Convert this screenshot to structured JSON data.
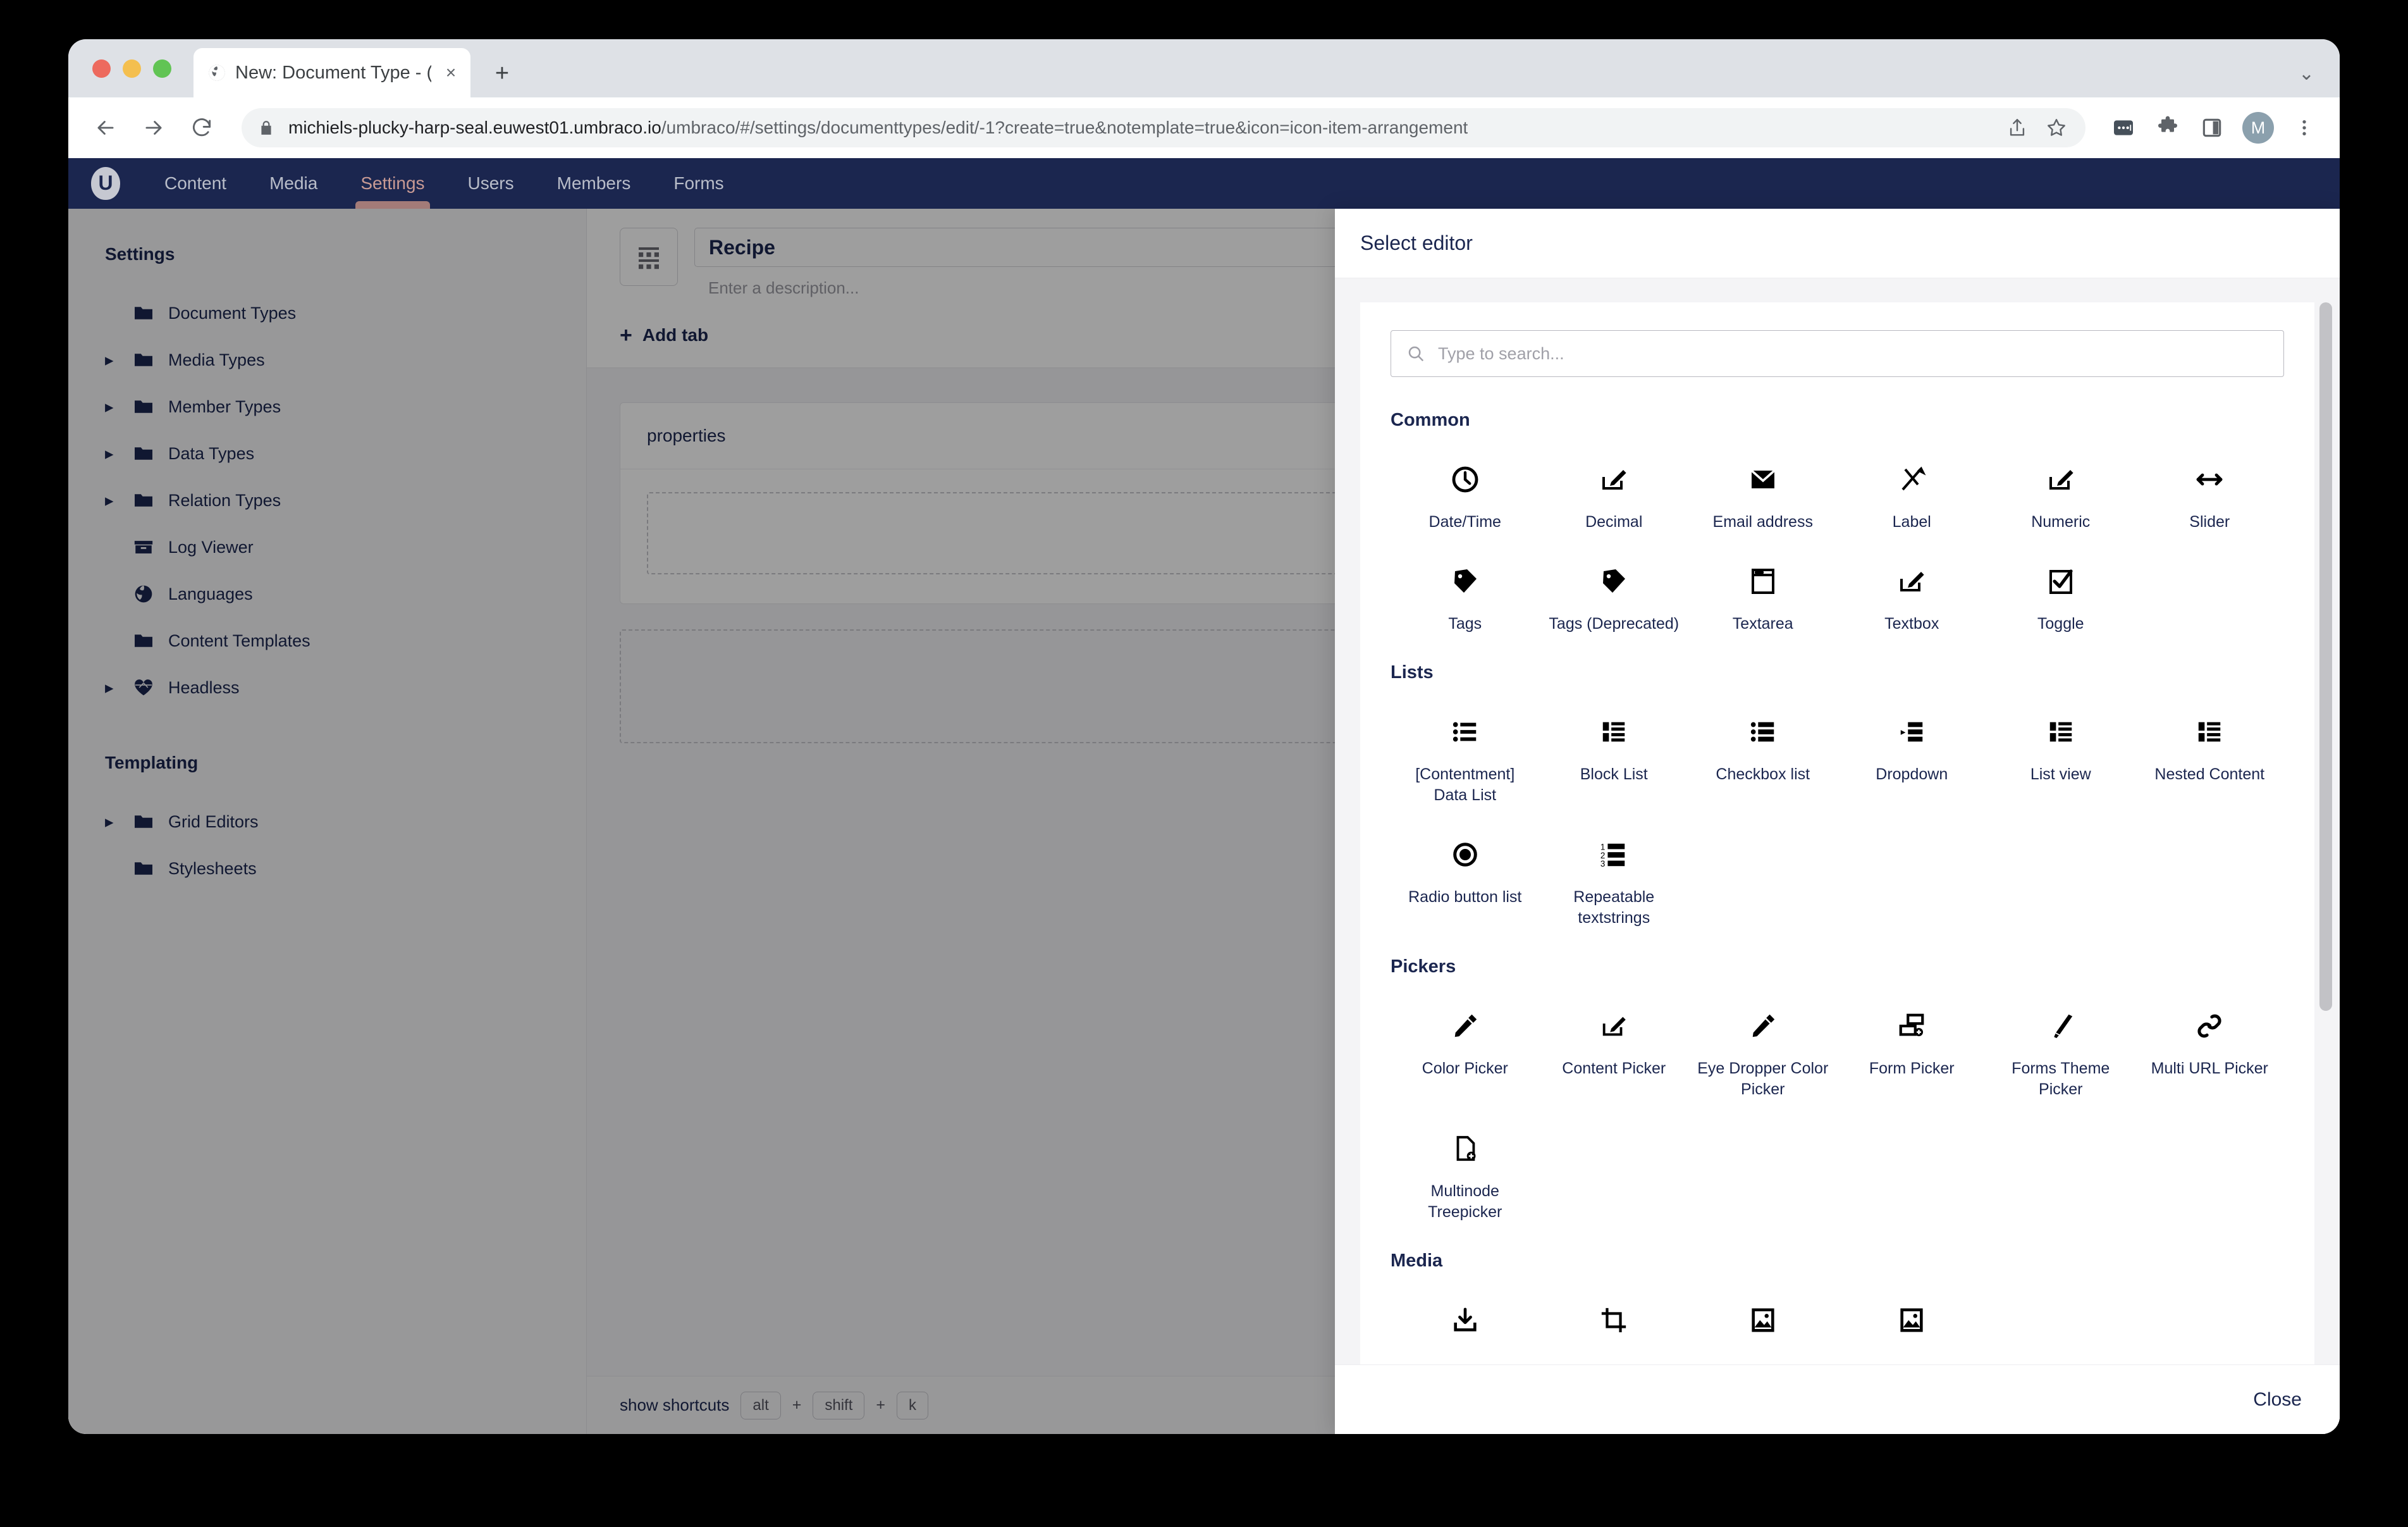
{
  "browser": {
    "tab": {
      "title": "New: Document Type - (Live) S",
      "favicon": "globe-icon",
      "close": "×"
    },
    "new_tab": "+",
    "tab_strip_chevron": "⌄",
    "url": {
      "host": "michiels-plucky-harp-seal.euwest01.umbraco.io",
      "path": "/umbraco/#/settings/documenttypes/edit/-1?create=true&notemplate=true&icon=icon-item-arrangement"
    },
    "toolbar": {
      "share": "share-icon",
      "bookmark": "star-icon",
      "passwords": "password-manager-icon",
      "extensions": "puzzle-icon",
      "sidepanel": "side-panel-icon",
      "profile_initial": "M",
      "menu": "three-dot-menu-icon"
    }
  },
  "umbraco_nav": {
    "logo": "U",
    "items": [
      {
        "label": "Content",
        "active": false
      },
      {
        "label": "Media",
        "active": false
      },
      {
        "label": "Settings",
        "active": true
      },
      {
        "label": "Users",
        "active": false
      },
      {
        "label": "Members",
        "active": false
      },
      {
        "label": "Forms",
        "active": false
      }
    ],
    "active_color": "#c89a94",
    "bar_color": "#1b264f"
  },
  "sidebar": {
    "heading": "Settings",
    "items": [
      {
        "label": "Document Types",
        "icon": "folder-icon",
        "expandable": false
      },
      {
        "label": "Media Types",
        "icon": "folder-icon",
        "expandable": true
      },
      {
        "label": "Member Types",
        "icon": "folder-icon",
        "expandable": true
      },
      {
        "label": "Data Types",
        "icon": "folder-icon",
        "expandable": true
      },
      {
        "label": "Relation Types",
        "icon": "folder-icon",
        "expandable": true
      },
      {
        "label": "Log Viewer",
        "icon": "box-icon",
        "expandable": false
      },
      {
        "label": "Languages",
        "icon": "globe-icon",
        "expandable": false
      },
      {
        "label": "Content Templates",
        "icon": "folder-icon",
        "expandable": false
      },
      {
        "label": "Headless",
        "icon": "heart-icon",
        "expandable": true
      }
    ],
    "heading2": "Templating",
    "items2": [
      {
        "label": "Grid Editors",
        "icon": "folder-icon",
        "expandable": true
      },
      {
        "label": "Stylesheets",
        "icon": "folder-icon",
        "expandable": false
      }
    ]
  },
  "editor": {
    "icon": "item-arrangement-icon",
    "name": "Recipe",
    "description_placeholder": "Enter a description...",
    "add_tab_label": "Add tab",
    "add_tab_plus": "+",
    "group_title": "properties",
    "footer": {
      "shortcut_label": "show shortcuts",
      "keys": [
        "alt",
        "shift",
        "k"
      ],
      "plus": "+"
    }
  },
  "drawer": {
    "title": "Select editor",
    "search_placeholder": "Type to search...",
    "close_label": "Close",
    "sections": [
      {
        "title": "Common",
        "items": [
          {
            "label": "Date/Time",
            "icon": "clock-icon"
          },
          {
            "label": "Decimal",
            "icon": "edit-field-icon"
          },
          {
            "label": "Email address",
            "icon": "envelope-icon"
          },
          {
            "label": "Label",
            "icon": "label-icon"
          },
          {
            "label": "Numeric",
            "icon": "edit-field-icon"
          },
          {
            "label": "Slider",
            "icon": "arrows-horizontal-icon"
          },
          {
            "label": "Tags",
            "icon": "tag-icon"
          },
          {
            "label": "Tags (Deprecated)",
            "icon": "tag-icon"
          },
          {
            "label": "Textarea",
            "icon": "textarea-icon"
          },
          {
            "label": "Textbox",
            "icon": "edit-field-icon"
          },
          {
            "label": "Toggle",
            "icon": "check-square-icon"
          }
        ]
      },
      {
        "title": "Lists",
        "items": [
          {
            "label": "[Contentment] Data List",
            "icon": "bullet-list-icon"
          },
          {
            "label": "Block List",
            "icon": "block-list-icon"
          },
          {
            "label": "Checkbox list",
            "icon": "checkbox-list-icon"
          },
          {
            "label": "Dropdown",
            "icon": "dropdown-icon"
          },
          {
            "label": "List view",
            "icon": "list-view-icon"
          },
          {
            "label": "Nested Content",
            "icon": "nested-content-icon"
          },
          {
            "label": "Radio button list",
            "icon": "radio-button-icon"
          },
          {
            "label": "Repeatable textstrings",
            "icon": "numbered-list-icon"
          }
        ]
      },
      {
        "title": "Pickers",
        "items": [
          {
            "label": "Color Picker",
            "icon": "eyedropper-icon"
          },
          {
            "label": "Content Picker",
            "icon": "edit-field-icon"
          },
          {
            "label": "Eye Dropper Color Picker",
            "icon": "eyedropper-icon"
          },
          {
            "label": "Form Picker",
            "icon": "form-icon"
          },
          {
            "label": "Forms Theme Picker",
            "icon": "brush-icon"
          },
          {
            "label": "Multi URL Picker",
            "icon": "link-icon"
          },
          {
            "label": "Multinode Treepicker",
            "icon": "document-add-icon"
          }
        ]
      },
      {
        "title": "Media",
        "items": [
          {
            "label": "",
            "icon": "download-icon"
          },
          {
            "label": "",
            "icon": "crop-icon"
          },
          {
            "label": "",
            "icon": "image-icon"
          },
          {
            "label": "",
            "icon": "image-icon"
          }
        ]
      }
    ]
  }
}
